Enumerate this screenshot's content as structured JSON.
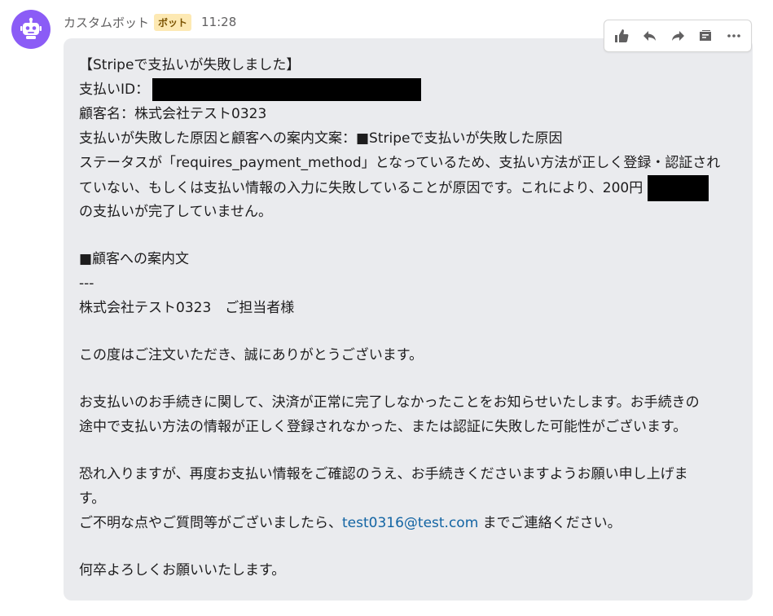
{
  "message": {
    "sender": "カスタムボット",
    "badge": "ボット",
    "time": "11:28",
    "lines": {
      "l1": "【Stripeで支払いが失敗しました】",
      "l2": "支払いID：",
      "l3": "顧客名：株式会社テスト0323",
      "l4": "支払いが失敗した原因と顧客への案内文案：■Stripeで支払いが失敗した原因",
      "l5": "ステータスが「requires_payment_method」となっているため、支払い方法が正しく登録・認証され",
      "l6": "ていない、もしくは支払い情報の入力に失敗していることが原因です。これにより、200円",
      "l7": "の支払いが完了していません。",
      "l8": "■顧客への案内文",
      "l9": "---",
      "l10": "株式会社テスト0323　ご担当者様",
      "l11": "この度はご注文いただき、誠にありがとうございます。",
      "l12": "お支払いのお手続きに関して、決済が正常に完了しなかったことをお知らせいたします。お手続きの",
      "l13": "途中で支払い方法の情報が正しく登録されなかった、または認証に失敗した可能性がございます。",
      "l14": "恐れ入りますが、再度お支払い情報をご確認のうえ、お手続きくださいますようお願い申し上げま",
      "l15": "す。",
      "l16a": "ご不明な点やご質問等がございましたら、",
      "l16_link": "test0316@test.com",
      "l16b": " までご連絡ください。",
      "l17": "何卒よろしくお願いいたします。"
    }
  },
  "toolbar": {
    "icons": [
      "thumbs-up-icon",
      "reply-icon",
      "forward-icon",
      "archive-icon",
      "more-icon"
    ]
  },
  "colors": {
    "avatar": "#8b5cf6",
    "bubble": "#eaebee",
    "link": "#1264a3",
    "badge_bg": "#fde9b3"
  }
}
